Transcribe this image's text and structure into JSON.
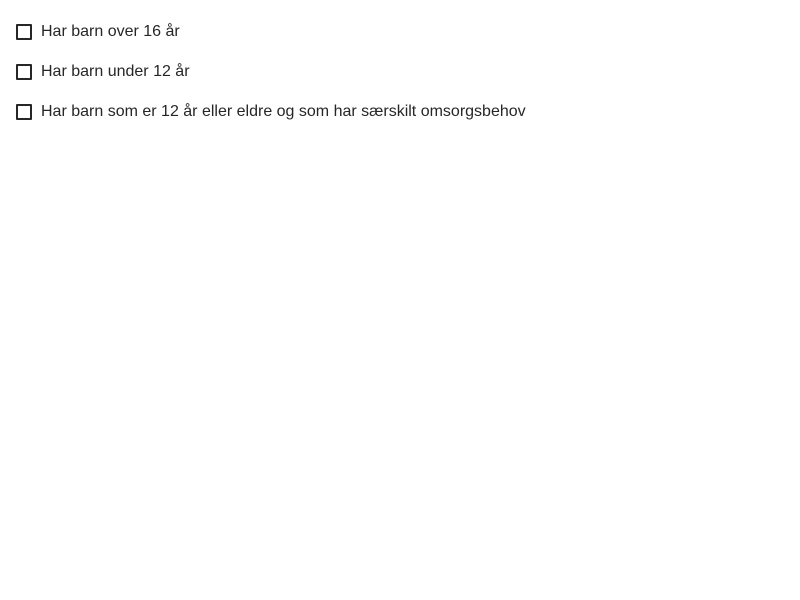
{
  "checkboxes": [
    {
      "label": "Har barn over 16 år",
      "checked": false
    },
    {
      "label": "Har barn under 12 år",
      "checked": false
    },
    {
      "label": "Har barn som er 12 år eller eldre og som har særskilt omsorgsbehov",
      "checked": false
    }
  ]
}
